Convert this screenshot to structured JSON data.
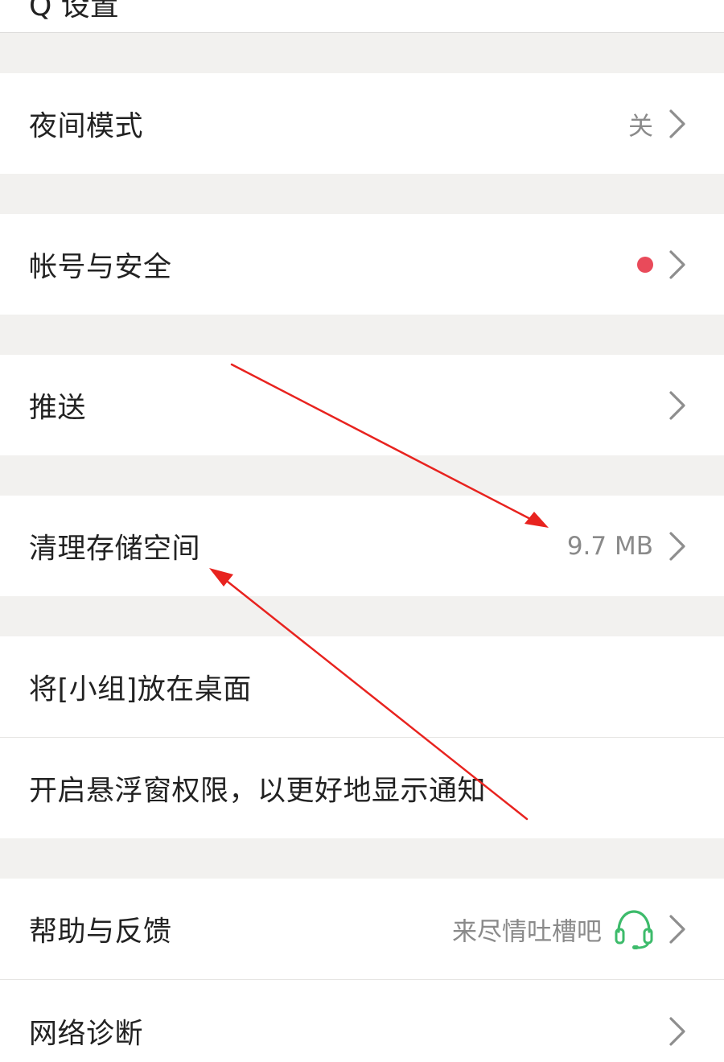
{
  "header": {
    "title_fragment": "Q 设置"
  },
  "settings": {
    "night_mode": {
      "label": "夜间模式",
      "value": "关"
    },
    "account_security": {
      "label": "帐号与安全"
    },
    "push": {
      "label": "推送"
    },
    "clear_storage": {
      "label": "清理存储空间",
      "value": "9.7 MB"
    },
    "widget_desktop": {
      "label": "将[小组]放在桌面"
    },
    "floating_window": {
      "label": "开启悬浮窗权限，以更好地显示通知"
    },
    "help_feedback": {
      "label": "帮助与反馈",
      "value": "来尽情吐槽吧"
    },
    "network_diagnosis": {
      "label": "网络诊断"
    }
  },
  "colors": {
    "accent_red_dot": "#e94a5a",
    "headset_green": "#3dbb6b",
    "annotation_arrow": "#e8231f",
    "chevron": "#8e8e8e"
  },
  "icons": {
    "chevron": "chevron-right-icon",
    "headset": "headset-icon",
    "dot": "notification-dot-icon"
  }
}
